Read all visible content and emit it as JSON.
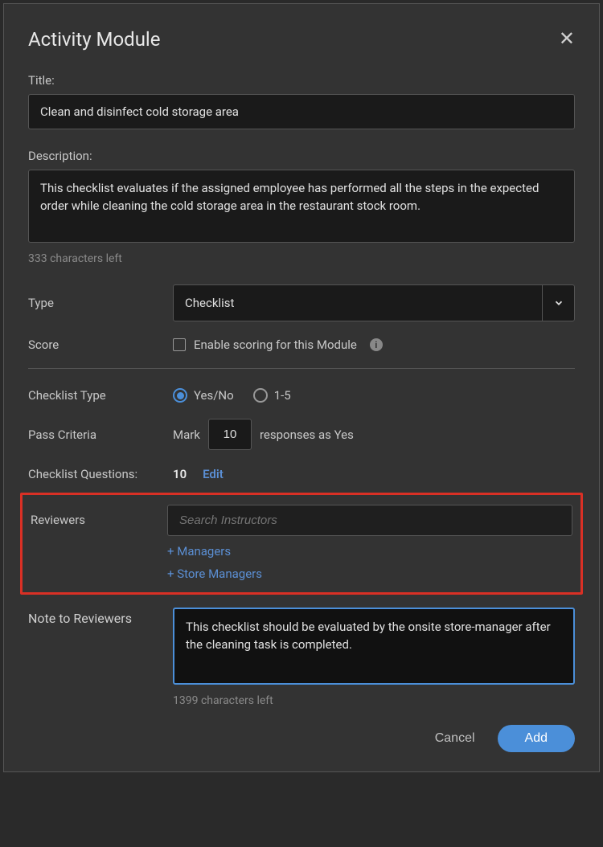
{
  "modal": {
    "title": "Activity Module",
    "close_aria": "Close"
  },
  "fields": {
    "title": {
      "label": "Title:",
      "value": "Clean and disinfect cold storage area"
    },
    "description": {
      "label": "Description:",
      "value": "This checklist evaluates if the assigned employee has performed all the steps in the expected order while cleaning the cold storage area in the restaurant stock room.",
      "chars_left": "333 characters left"
    },
    "type": {
      "label": "Type",
      "selected": "Checklist"
    },
    "score": {
      "label": "Score",
      "checkbox_label": "Enable scoring for this Module"
    },
    "checklist_type": {
      "label": "Checklist Type",
      "option1": "Yes/No",
      "option2": "1-5"
    },
    "pass_criteria": {
      "label": "Pass Criteria",
      "prefix": "Mark",
      "value": "10",
      "suffix": "responses as Yes"
    },
    "checklist_questions": {
      "label": "Checklist Questions:",
      "count": "10",
      "edit": "Edit"
    },
    "reviewers": {
      "label": "Reviewers",
      "search_placeholder": "Search Instructors",
      "add_managers": "+ Managers",
      "add_store_managers": "+ Store Managers"
    },
    "note": {
      "label": "Note to Reviewers",
      "value": "This checklist should be evaluated by the onsite store-manager after the cleaning task is completed.",
      "chars_left": "1399 characters left"
    }
  },
  "footer": {
    "cancel": "Cancel",
    "add": "Add"
  }
}
